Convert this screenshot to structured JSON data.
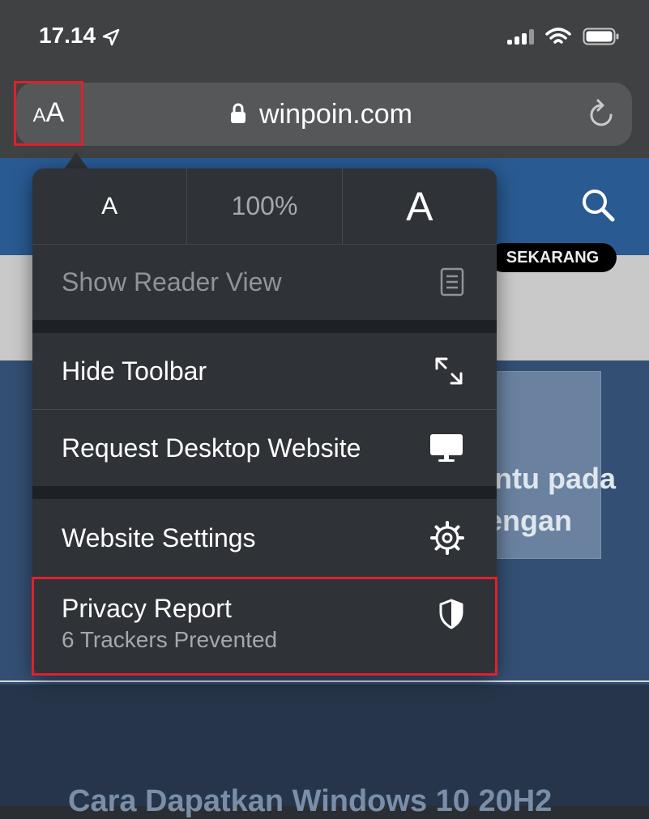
{
  "status_bar": {
    "time": "17.14"
  },
  "url_bar": {
    "aa_label": "AA",
    "url": "winpoin.com"
  },
  "background": {
    "banner_text": "SEKARANG",
    "article_line1": "ntu pada",
    "article_line2": "engan",
    "bottom_title": "Cara Dapatkan Windows 10 20H2"
  },
  "popover": {
    "font_small": "A",
    "zoom": "100%",
    "font_large": "A",
    "items": [
      {
        "label": "Show Reader View",
        "icon": "reader-view-icon",
        "enabled": false
      },
      {
        "label": "Hide Toolbar",
        "icon": "expand-arrows-icon",
        "enabled": true
      },
      {
        "label": "Request Desktop Website",
        "icon": "desktop-monitor-icon",
        "enabled": true
      },
      {
        "label": "Website Settings",
        "icon": "gear-icon",
        "enabled": true
      },
      {
        "label": "Privacy Report",
        "sublabel": "6 Trackers Prevented",
        "icon": "shield-icon",
        "enabled": true
      }
    ]
  },
  "colors": {
    "highlight": "#e0202b"
  }
}
